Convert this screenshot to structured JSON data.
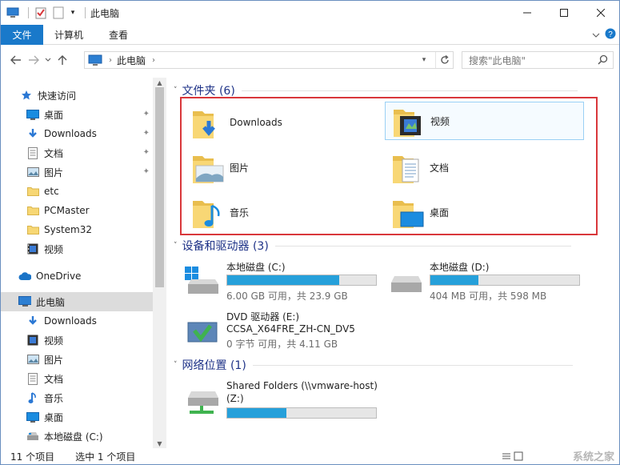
{
  "window": {
    "title": "此电脑",
    "quick_access_dropdown": "▾"
  },
  "ribbon": {
    "tabs": [
      "文件",
      "计算机",
      "查看"
    ]
  },
  "address": {
    "crumb": "此电脑",
    "search_placeholder": "搜索\"此电脑\""
  },
  "nav": {
    "quick_access": "快速访问",
    "items": [
      {
        "label": "桌面",
        "icon": "desktop-icon",
        "pinned": true
      },
      {
        "label": "Downloads",
        "icon": "download-icon",
        "pinned": true
      },
      {
        "label": "文档",
        "icon": "document-icon",
        "pinned": true
      },
      {
        "label": "图片",
        "icon": "picture-icon",
        "pinned": true
      },
      {
        "label": "etc",
        "icon": "folder-icon",
        "pinned": false
      },
      {
        "label": "PCMaster",
        "icon": "folder-icon",
        "pinned": false
      },
      {
        "label": "System32",
        "icon": "folder-icon",
        "pinned": false
      },
      {
        "label": "视频",
        "icon": "video-icon",
        "pinned": false
      }
    ],
    "onedrive": "OneDrive",
    "this_pc": "此电脑",
    "pc_items": [
      {
        "label": "Downloads",
        "icon": "download-icon"
      },
      {
        "label": "视频",
        "icon": "video-icon"
      },
      {
        "label": "图片",
        "icon": "picture-icon"
      },
      {
        "label": "文档",
        "icon": "document-icon"
      },
      {
        "label": "音乐",
        "icon": "music-icon"
      },
      {
        "label": "桌面",
        "icon": "desktop-icon"
      },
      {
        "label": "本地磁盘 (C:)",
        "icon": "drive-icon"
      }
    ]
  },
  "content": {
    "folders_header": "文件夹 (6)",
    "folders": [
      {
        "label": "Downloads",
        "icon": "download-folder-icon"
      },
      {
        "label": "视频",
        "icon": "video-folder-icon"
      },
      {
        "label": "图片",
        "icon": "picture-folder-icon"
      },
      {
        "label": "文档",
        "icon": "document-folder-icon"
      },
      {
        "label": "音乐",
        "icon": "music-folder-icon"
      },
      {
        "label": "桌面",
        "icon": "desktop-folder-icon"
      }
    ],
    "devices_header": "设备和驱动器 (3)",
    "drives": [
      {
        "name": "本地磁盘 (C:)",
        "size": "6.00 GB 可用，共 23.9 GB",
        "used_fraction": 0.75
      },
      {
        "name": "本地磁盘 (D:)",
        "size": "404 MB 可用，共 598 MB",
        "used_fraction": 0.32
      }
    ],
    "dvd": {
      "name": "DVD 驱动器 (E:)",
      "label": "CCSA_X64FRE_ZH-CN_DV5",
      "size": "0 字节 可用，共 4.11 GB"
    },
    "network_header": "网络位置 (1)",
    "network": {
      "name": "Shared Folders (\\\\vmware-host)",
      "sub": "(Z:)",
      "used_fraction": 0.4
    }
  },
  "status": {
    "count": "11 个项目",
    "selected": "选中 1 个项目"
  },
  "colors": {
    "accent": "#1979ca",
    "highlight": "#d9373b",
    "bar": "#26a0da"
  }
}
